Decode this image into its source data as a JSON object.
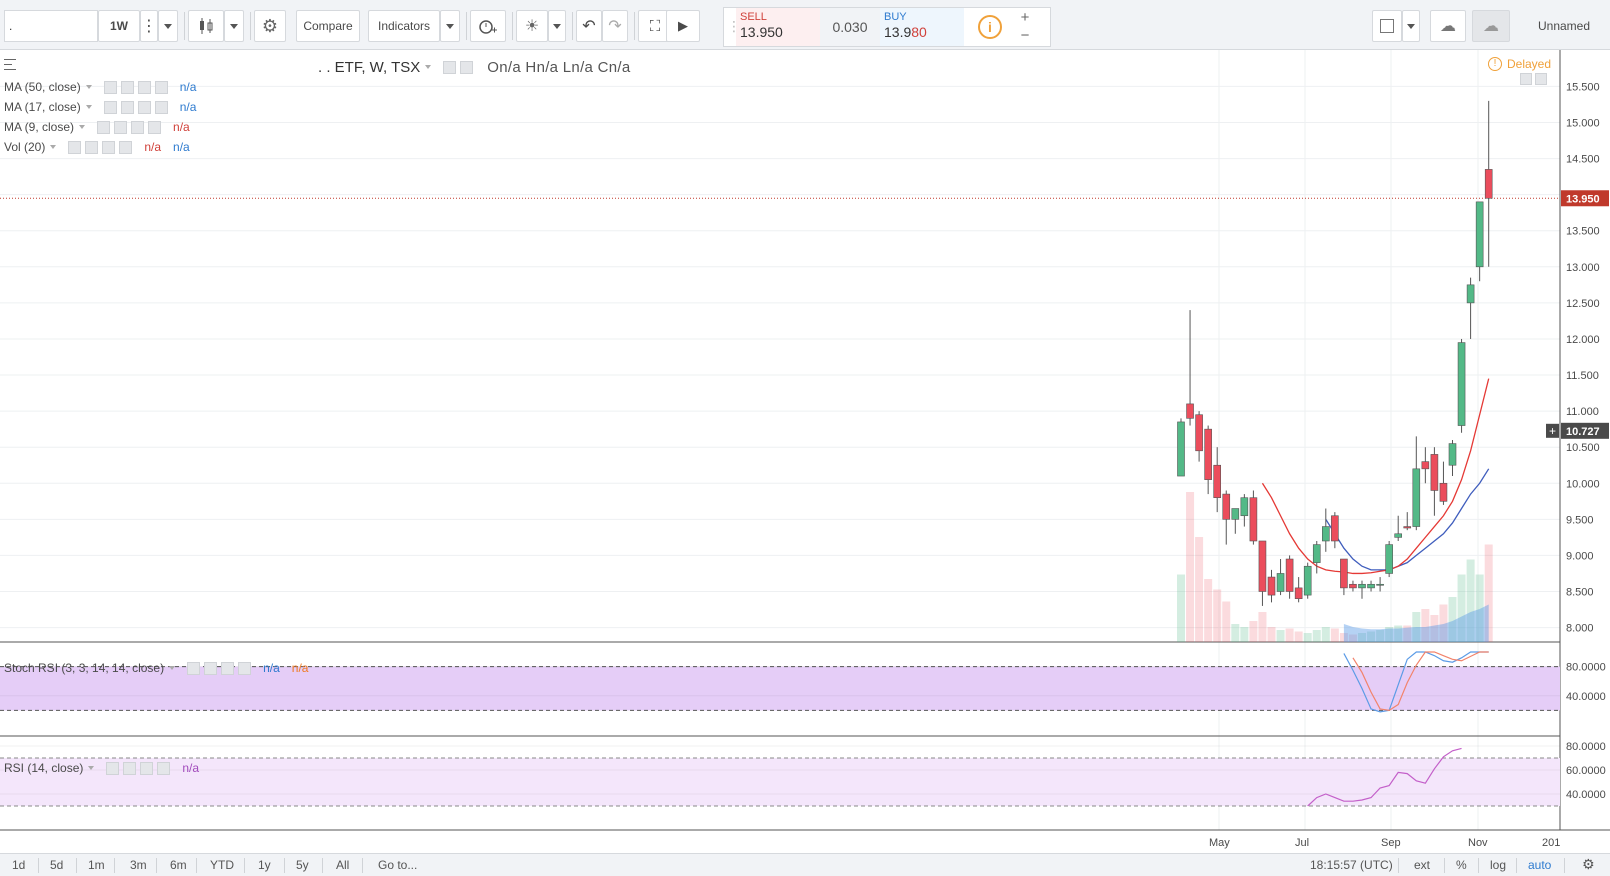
{
  "toolbar": {
    "symbol_value": ".",
    "interval": "1W",
    "compare_label": "Compare",
    "indicators_label": "Indicators",
    "layout_name": "Unnamed"
  },
  "trade": {
    "sell_label": "SELL",
    "sell_price": "13.950",
    "spread": "0.030",
    "buy_label": "BUY",
    "buy_price_main": "13.9",
    "buy_price_tail": "80",
    "plus": "+",
    "minus": "−",
    "info": "i"
  },
  "chart_data": [
    {
      "type": "candlestick",
      "title": ". . ETF, W, TSX",
      "ohlc_readout": "On/a  Hn/a  Ln/a  Cn/a",
      "delayed_label": "Delayed",
      "x_ticks": [
        "May",
        "Jul",
        "Sep",
        "Nov",
        "201"
      ],
      "y_ticks": [
        "15.500",
        "15.000",
        "14.500",
        "14.000",
        "13.500",
        "13.000",
        "12.500",
        "12.000",
        "11.500",
        "11.000",
        "10.500",
        "10.000",
        "9.500",
        "9.000",
        "8.500",
        "8.000"
      ],
      "ylim": [
        7.8,
        15.7
      ],
      "last_price_label": "13.950",
      "last_price": 13.95,
      "crosshair_price_label": "10.727",
      "crosshair_price": 10.727,
      "candles": [
        {
          "o": 10.1,
          "h": 10.9,
          "l": 10.1,
          "c": 10.85,
          "v": 0.45
        },
        {
          "o": 11.1,
          "h": 12.4,
          "l": 10.8,
          "c": 10.9,
          "v": 1.0
        },
        {
          "o": 10.95,
          "h": 11.0,
          "l": 10.3,
          "c": 10.45,
          "v": 0.7
        },
        {
          "o": 10.75,
          "h": 10.8,
          "l": 9.85,
          "c": 10.05,
          "v": 0.42
        },
        {
          "o": 10.25,
          "h": 10.5,
          "l": 9.6,
          "c": 9.8,
          "v": 0.35
        },
        {
          "o": 9.85,
          "h": 9.9,
          "l": 9.15,
          "c": 9.5,
          "v": 0.27
        },
        {
          "o": 9.5,
          "h": 9.6,
          "l": 9.3,
          "c": 9.65,
          "v": 0.12
        },
        {
          "o": 9.55,
          "h": 9.85,
          "l": 9.4,
          "c": 9.8,
          "v": 0.1
        },
        {
          "o": 9.8,
          "h": 9.9,
          "l": 9.15,
          "c": 9.2,
          "v": 0.14
        },
        {
          "o": 9.2,
          "h": 9.2,
          "l": 8.3,
          "c": 8.5,
          "v": 0.2
        },
        {
          "o": 8.7,
          "h": 8.8,
          "l": 8.35,
          "c": 8.45,
          "v": 0.1
        },
        {
          "o": 8.5,
          "h": 8.95,
          "l": 8.45,
          "c": 8.75,
          "v": 0.08
        },
        {
          "o": 8.95,
          "h": 9.0,
          "l": 8.4,
          "c": 8.5,
          "v": 0.09
        },
        {
          "o": 8.55,
          "h": 8.7,
          "l": 8.35,
          "c": 8.4,
          "v": 0.07
        },
        {
          "o": 8.45,
          "h": 8.9,
          "l": 8.4,
          "c": 8.85,
          "v": 0.06
        },
        {
          "o": 8.9,
          "h": 9.2,
          "l": 8.75,
          "c": 9.15,
          "v": 0.08
        },
        {
          "o": 9.2,
          "h": 9.65,
          "l": 9.05,
          "c": 9.4,
          "v": 0.1
        },
        {
          "o": 9.55,
          "h": 9.6,
          "l": 9.1,
          "c": 9.2,
          "v": 0.09
        },
        {
          "o": 8.95,
          "h": 8.95,
          "l": 8.45,
          "c": 8.55,
          "v": 0.06
        },
        {
          "o": 8.6,
          "h": 8.65,
          "l": 8.5,
          "c": 8.55,
          "v": 0.05
        },
        {
          "o": 8.55,
          "h": 8.65,
          "l": 8.4,
          "c": 8.6,
          "v": 0.06
        },
        {
          "o": 8.55,
          "h": 8.65,
          "l": 8.5,
          "c": 8.6,
          "v": 0.07
        },
        {
          "o": 8.6,
          "h": 8.7,
          "l": 8.5,
          "c": 8.6,
          "v": 0.08
        },
        {
          "o": 8.75,
          "h": 9.2,
          "l": 8.7,
          "c": 9.15,
          "v": 0.1
        },
        {
          "o": 9.25,
          "h": 9.55,
          "l": 9.2,
          "c": 9.3,
          "v": 0.11
        },
        {
          "o": 9.4,
          "h": 9.6,
          "l": 9.35,
          "c": 9.38,
          "v": 0.11
        },
        {
          "o": 9.4,
          "h": 10.65,
          "l": 9.35,
          "c": 10.2,
          "v": 0.2
        },
        {
          "o": 10.3,
          "h": 10.5,
          "l": 10.0,
          "c": 10.2,
          "v": 0.22
        },
        {
          "o": 10.4,
          "h": 10.5,
          "l": 9.55,
          "c": 9.9,
          "v": 0.18
        },
        {
          "o": 10.0,
          "h": 10.3,
          "l": 9.7,
          "c": 9.75,
          "v": 0.25
        },
        {
          "o": 10.25,
          "h": 10.6,
          "l": 10.1,
          "c": 10.55,
          "v": 0.3
        },
        {
          "o": 10.8,
          "h": 12.0,
          "l": 10.7,
          "c": 11.95,
          "v": 0.45
        },
        {
          "o": 12.5,
          "h": 12.85,
          "l": 12.0,
          "c": 12.75,
          "v": 0.55
        },
        {
          "o": 13.0,
          "h": 13.45,
          "l": 12.8,
          "c": 13.9,
          "v": 0.45
        },
        {
          "o": 14.35,
          "h": 15.3,
          "l": 13.0,
          "c": 13.95,
          "v": 0.65
        }
      ],
      "ma_red": [
        null,
        null,
        null,
        null,
        null,
        null,
        null,
        null,
        null,
        10.0,
        9.8,
        9.55,
        9.3,
        9.1,
        8.95,
        8.85,
        8.8,
        8.78,
        8.77,
        8.75,
        8.75,
        8.76,
        8.78,
        8.8,
        8.85,
        8.95,
        9.1,
        9.25,
        9.4,
        9.55,
        9.75,
        10.05,
        10.45,
        10.95,
        11.45
      ],
      "ma_blue": [
        null,
        null,
        null,
        null,
        null,
        null,
        null,
        null,
        null,
        null,
        null,
        null,
        null,
        null,
        null,
        null,
        9.5,
        9.3,
        9.1,
        8.95,
        8.85,
        8.8,
        8.8,
        8.8,
        8.85,
        8.9,
        9.0,
        9.1,
        9.2,
        9.3,
        9.45,
        9.65,
        9.85,
        10.0,
        10.2
      ]
    },
    {
      "type": "line",
      "title": "Stoch RSI (3, 3, 14, 14, close)",
      "y_ticks": [
        "80.0000",
        "40.0000"
      ],
      "ylim": [
        0,
        100
      ],
      "band": [
        20,
        80
      ],
      "x_start_index": 18,
      "series": [
        {
          "values": [
            98,
            75,
            50,
            22,
            18,
            20,
            55,
            90,
            100,
            100,
            95,
            88,
            86,
            92,
            100,
            100,
            100
          ]
        },
        {
          "values": [
            null,
            92,
            72,
            45,
            22,
            20,
            28,
            58,
            82,
            100,
            100,
            95,
            90,
            88,
            94,
            100,
            100
          ]
        }
      ]
    },
    {
      "type": "line",
      "title": "RSI (14, close)",
      "y_ticks": [
        "80.0000",
        "60.0000",
        "40.0000"
      ],
      "ylim": [
        10,
        85
      ],
      "band": [
        30,
        70
      ],
      "x_start_index": 14,
      "series": [
        {
          "values": [
            30,
            37,
            40,
            37,
            34,
            34,
            35,
            37,
            45,
            47,
            58,
            57,
            51,
            49,
            61,
            71,
            76,
            78
          ]
        }
      ]
    }
  ],
  "legend": [
    {
      "label": "MA (50, close)",
      "value": "n/a"
    },
    {
      "label": "MA (17, close)",
      "value": "n/a"
    },
    {
      "label": "MA (9, close)",
      "value": "n/a"
    },
    {
      "label": "Vol (20)",
      "value": "n/a",
      "value2": "n/a"
    }
  ],
  "stoch_legend": {
    "label": "Stoch RSI (3, 3, 14, 14, close)",
    "v1": "n/a",
    "v2": "n/a"
  },
  "rsi_legend": {
    "label": "RSI (14, close)",
    "v1": "n/a"
  },
  "bottom": {
    "ranges": [
      "1d",
      "5d",
      "1m",
      "3m",
      "6m",
      "YTD",
      "1y",
      "5y",
      "All"
    ],
    "goto": "Go to...",
    "time": "18:15:57 (UTC)",
    "ext": "ext",
    "percent": "%",
    "log": "log",
    "auto": "auto"
  },
  "colors": {
    "up": "#53b987",
    "down": "#eb4d5c",
    "ma_red": "#e53935",
    "ma_blue": "#3f5dbd",
    "stoch_k": "#5b9be6",
    "stoch_d": "#f2836b",
    "rsi": "#c35fc9",
    "price_line": "#c0392b"
  }
}
